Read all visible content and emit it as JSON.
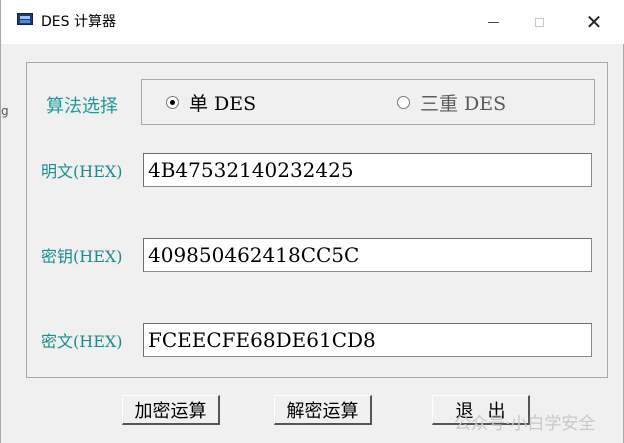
{
  "window": {
    "title": "DES 计算器",
    "controls": {
      "minimize": "—",
      "maximize": "□",
      "close": "✕"
    }
  },
  "side_glyph": "g",
  "algorithm": {
    "label": "算法选择",
    "options": [
      {
        "label": "单  DES",
        "selected": true
      },
      {
        "label": "三重  DES",
        "selected": false
      }
    ]
  },
  "fields": {
    "plaintext": {
      "label": "明文(HEX)",
      "value": "4B47532140232425"
    },
    "key": {
      "label": "密钥(HEX)",
      "value": "409850462418CC5C"
    },
    "ciphertext": {
      "label": "密文(HEX)",
      "value": "FCEECFE68DE61CD8"
    }
  },
  "buttons": {
    "encrypt": "加密运算",
    "decrypt": "解密运算",
    "exit": "退出"
  },
  "watermark": "公众号·小白学安全",
  "icons": [
    "app-window-icon",
    "minimize-icon",
    "maximize-icon",
    "close-icon"
  ]
}
